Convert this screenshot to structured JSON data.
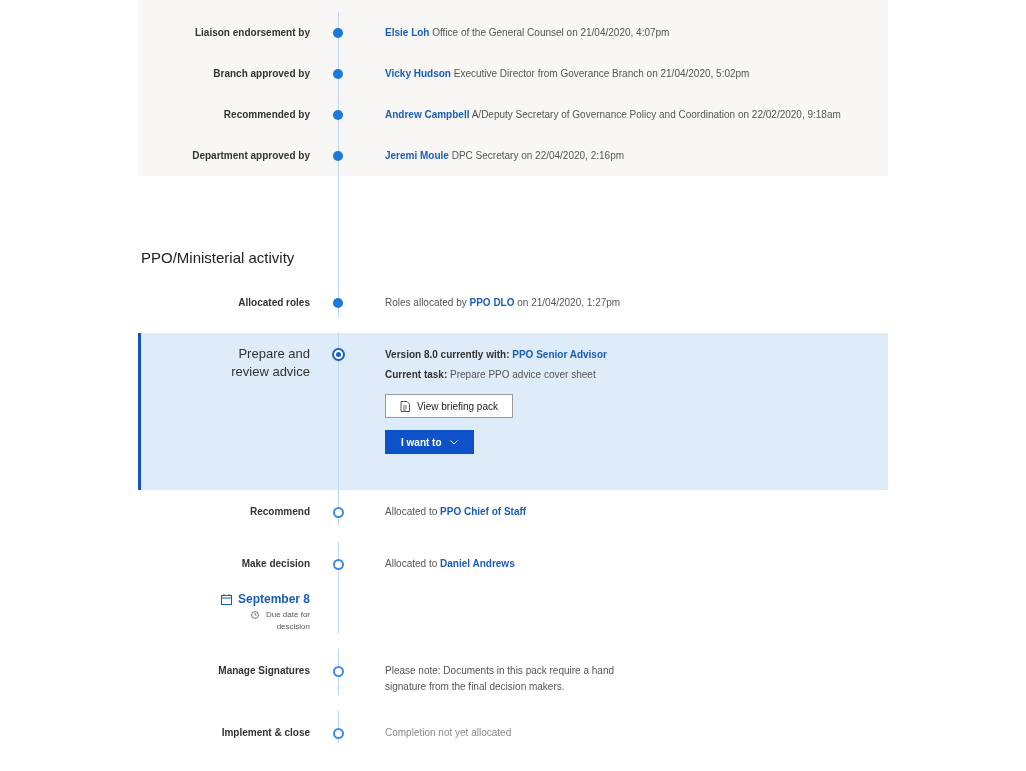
{
  "approvals": [
    {
      "label": "Liaison endorsement by",
      "kind": "done",
      "text": [
        {
          "kind": "link",
          "text": "Elsie Loh"
        },
        {
          "kind": "plain",
          "text": " Office of the General Counsel on 21/04/2020, 4:07pm"
        }
      ]
    },
    {
      "label": "Branch approved by",
      "kind": "done",
      "text": [
        {
          "kind": "link",
          "text": "Vicky Hudson"
        },
        {
          "kind": "plain",
          "text": " Executive Director from Goverance Branch on 21/04/2020, 5:02pm"
        }
      ]
    },
    {
      "label": "Recommended by",
      "kind": "done",
      "text": [
        {
          "kind": "link",
          "text": "Andrew Campbell"
        },
        {
          "kind": "plain",
          "text": " A/Deputy Secretary of Governance Policy and Coordination on 22/02/2020, 9:18am"
        }
      ]
    },
    {
      "label": "Department approved by",
      "kind": "done",
      "text": [
        {
          "kind": "link",
          "text": "Jeremi Moule"
        },
        {
          "kind": "plain",
          "text": " DPC Secretary on 22/04/2020, 2:16pm"
        }
      ]
    }
  ],
  "section_title": "PPO/Ministerial activity",
  "activities": [
    {
      "label": "Allocated roles",
      "kind": "done",
      "lines": [
        [
          {
            "kind": "plain",
            "text": "Roles allocated by "
          },
          {
            "kind": "link",
            "text": "PPO DLO"
          },
          {
            "kind": "plain",
            "text": " on 21/04/2020, 1:27pm"
          }
        ]
      ]
    },
    {
      "label": "Prepare and review advice",
      "kind": "current",
      "lines": [
        [
          {
            "kind": "strong",
            "text": "Version 8.0 currently with: "
          },
          {
            "kind": "link",
            "text": "PPO Senior Advisor"
          }
        ],
        [
          {
            "kind": "strong",
            "text": "Current task:"
          },
          {
            "kind": "plain",
            "text": " Prepare PPO advice cover sheet"
          }
        ]
      ],
      "buttons": [
        {
          "kind": "secondary",
          "label": "View briefing pack"
        },
        {
          "kind": "primary",
          "label": "I want to"
        }
      ]
    },
    {
      "label": "Recommend",
      "kind": "pending",
      "lines": [
        [
          {
            "kind": "plain",
            "text": "Allocated to "
          },
          {
            "kind": "link",
            "text": "PPO Chief of Staff"
          }
        ]
      ]
    },
    {
      "label": "Make decision",
      "kind": "pending",
      "lines": [
        [
          {
            "kind": "plain",
            "text": "Allocated to "
          },
          {
            "kind": "link",
            "text": "Daniel Andrews"
          }
        ]
      ],
      "due": {
        "date": "September 8",
        "note": "Due date for descision"
      }
    },
    {
      "label": "Manage Signatures",
      "kind": "pending",
      "lines": [
        [
          {
            "kind": "plain",
            "text": "Please note: Documents in this pack require a hand signature from the final decision makers."
          }
        ]
      ]
    },
    {
      "label": "Implement & close",
      "kind": "pending",
      "lines": [
        [
          {
            "kind": "muted",
            "text": "Completion not yet allocated"
          }
        ]
      ]
    }
  ]
}
